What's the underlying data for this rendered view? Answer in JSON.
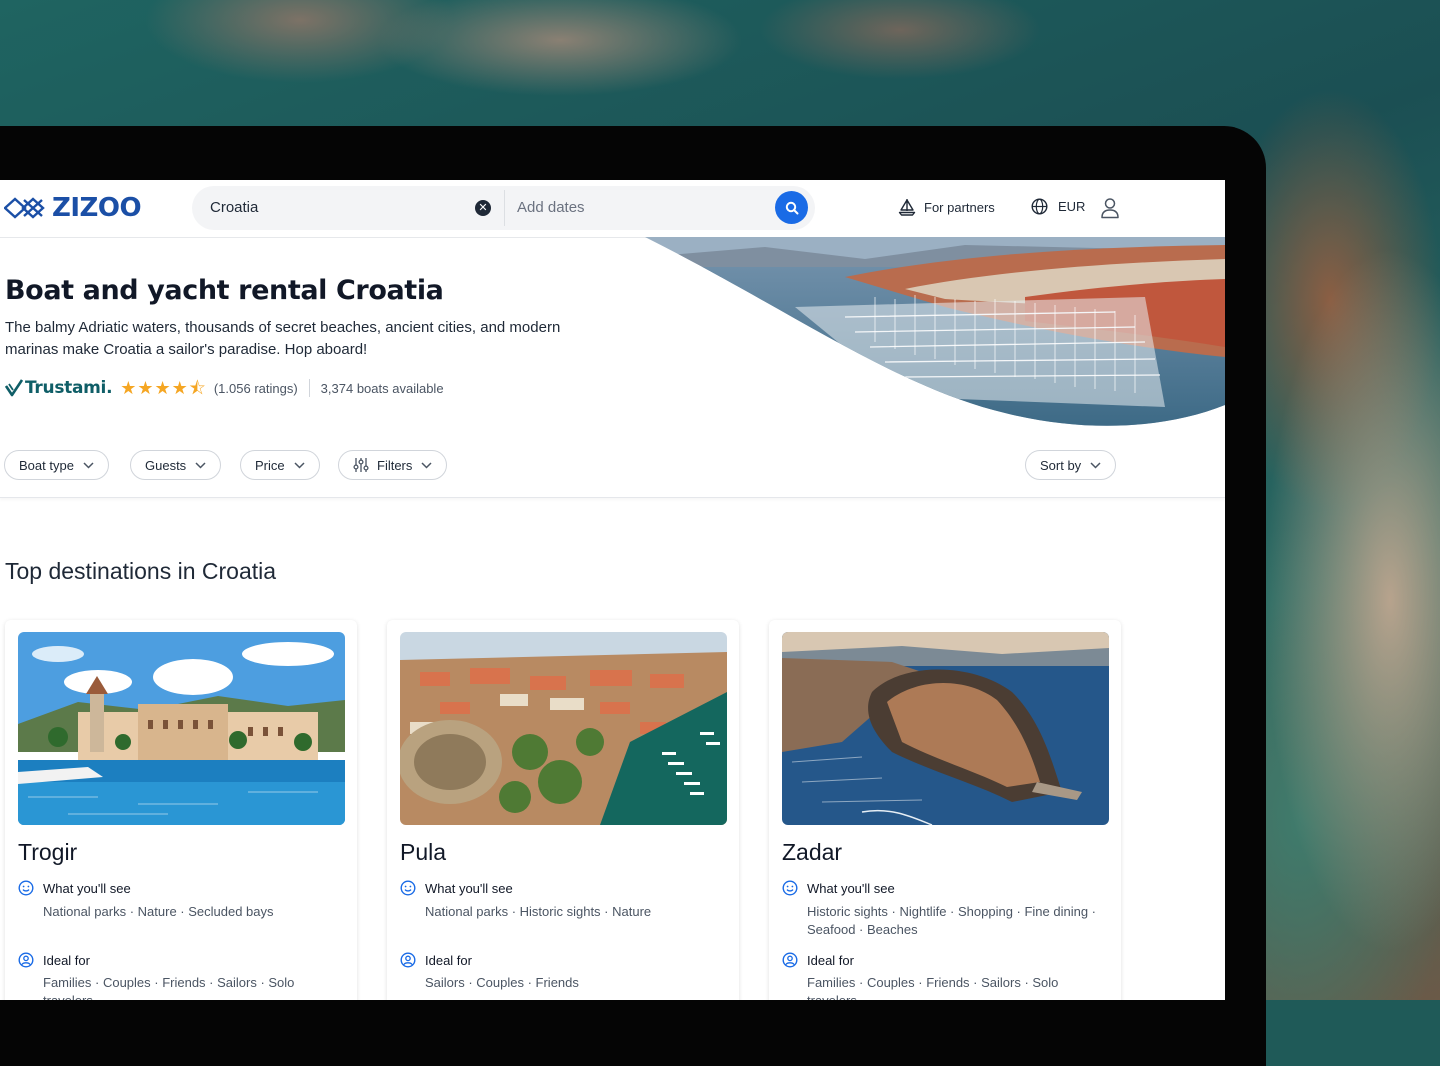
{
  "brand": {
    "logo_text": "ZIZOO",
    "color": "#1b4fa6"
  },
  "search": {
    "where_value": "Croatia",
    "dates_placeholder": "Add dates",
    "accent": "#1a6be6"
  },
  "nav": {
    "partners_label": "For partners",
    "currency_label": "EUR"
  },
  "hero": {
    "title": "Boat and yacht rental Croatia",
    "description": "The balmy Adriatic waters, thousands of secret beaches, ancient cities, and modern marinas make Croatia a sailor's paradise. Hop aboard!",
    "trust_brand": "Trustami.",
    "rating_stars": 4.5,
    "rating_count": "(1.056 ratings)",
    "boats_available": "3,374 boats available"
  },
  "filters": {
    "boat_type": "Boat type",
    "guests": "Guests",
    "price": "Price",
    "filters": "Filters",
    "sort_by": "Sort by"
  },
  "destinations": {
    "section_title": "Top destinations in Croatia",
    "cards": [
      {
        "title": "Trogir",
        "see_label": "What you'll see",
        "see_text": "National parks · Nature · Secluded bays",
        "ideal_label": "Ideal for",
        "ideal_text": "Families · Couples · Friends · Sailors · Solo travelers"
      },
      {
        "title": "Pula",
        "see_label": "What you'll see",
        "see_text": "National parks · Historic sights · Nature",
        "ideal_label": "Ideal for",
        "ideal_text": "Sailors · Couples · Friends"
      },
      {
        "title": "Zadar",
        "see_label": "What you'll see",
        "see_text": "Historic sights · Nightlife · Shopping · Fine dining · Seafood · Beaches",
        "ideal_label": "Ideal for",
        "ideal_text": "Families · Couples · Friends · Sailors · Solo travelers"
      }
    ]
  },
  "colors": {
    "star": "#f5a623",
    "trust": "#0f5e67",
    "text": "#1f2937",
    "muted": "#4b5563"
  }
}
